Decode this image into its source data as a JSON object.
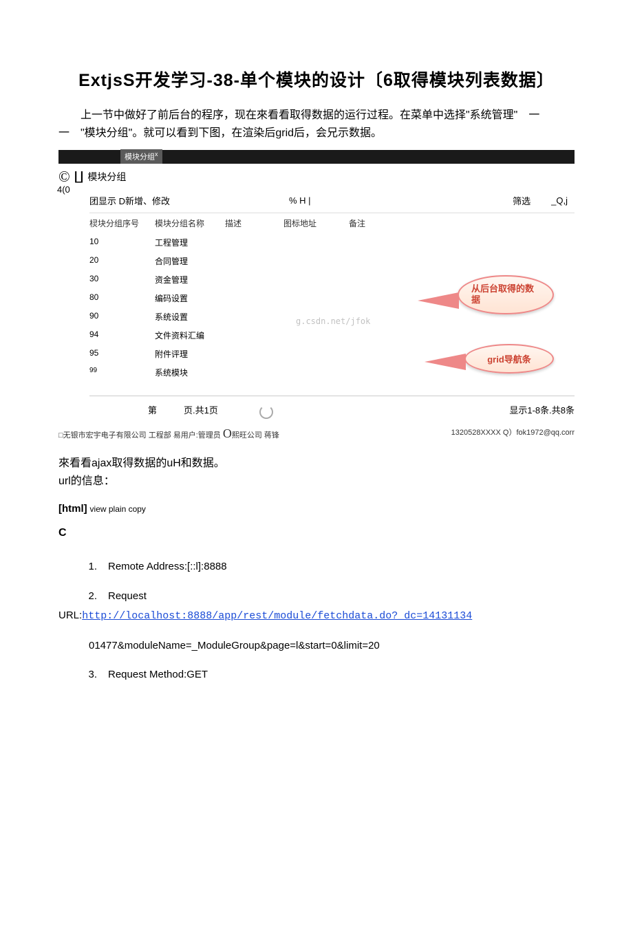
{
  "title": "ExtjsS开发学习-38-单个模块的设计〔6取得模块列表数据〕",
  "intro": "上一节中做好了前后台的程序，现在來看看取得数据的运行过程。在菜单中选择\"系统管理\"　一一　\"模块分组\"。就可以看到下图，在渲染后grid后，会兄示数据。",
  "tab": "模块分组",
  "groupLabel": "模块分组",
  "countLeft": "4(0",
  "toolbar": {
    "show": "团显示 D新增、修改",
    "mid": "% H |",
    "filter": "筛选",
    "search": "_Q,j"
  },
  "headers": {
    "c1": "棂块分组序号",
    "c2": "模块分组名称",
    "c3": "描述",
    "c4": "图标地址",
    "c5": "备注"
  },
  "rows": [
    {
      "n": "10",
      "name": "工程管理"
    },
    {
      "n": "20",
      "name": "合同管理"
    },
    {
      "n": "30",
      "name": "资金管理"
    },
    {
      "n": "80",
      "name": "编码设置"
    },
    {
      "n": "90",
      "name": "系统设置"
    },
    {
      "n": "94",
      "name": "文件资料汇编"
    },
    {
      "n": "95",
      "name": "附件评理"
    },
    {
      "n": "99",
      "name": "系统模块"
    }
  ],
  "bubble1": "从后台取得的数据",
  "bubble2": "grid导航条",
  "watermark": "g.csdn.net/jfok",
  "pager": {
    "left": "第　　　页.共1页",
    "right": "显示1-8条.共8条"
  },
  "status": {
    "left": "□无银市宏宇电子有限公司 工程部 易用户:管理员 ",
    "mid": "熙旺公司 蒋锋",
    "right": "1320528XXXX Q）fok1972@qq.corr"
  },
  "after1": "來看看ajax取得数据的uH和数据。",
  "after2": "url的信息：",
  "codeLabel": "[html]",
  "codeLabel2": "view plain copy",
  "cLetter": "C",
  "list": {
    "i1": "Remote Address:[::l]:8888",
    "i2a": "Request",
    "i2b": "URL:",
    "i2url": "http://localhost:8888/app/rest/module/fetchdata.do?_dc=14131134",
    "i2c": "01477&moduleName=_ModuleGroup&page=l&start=0&limit=20",
    "i3": "Request Method:GET"
  }
}
